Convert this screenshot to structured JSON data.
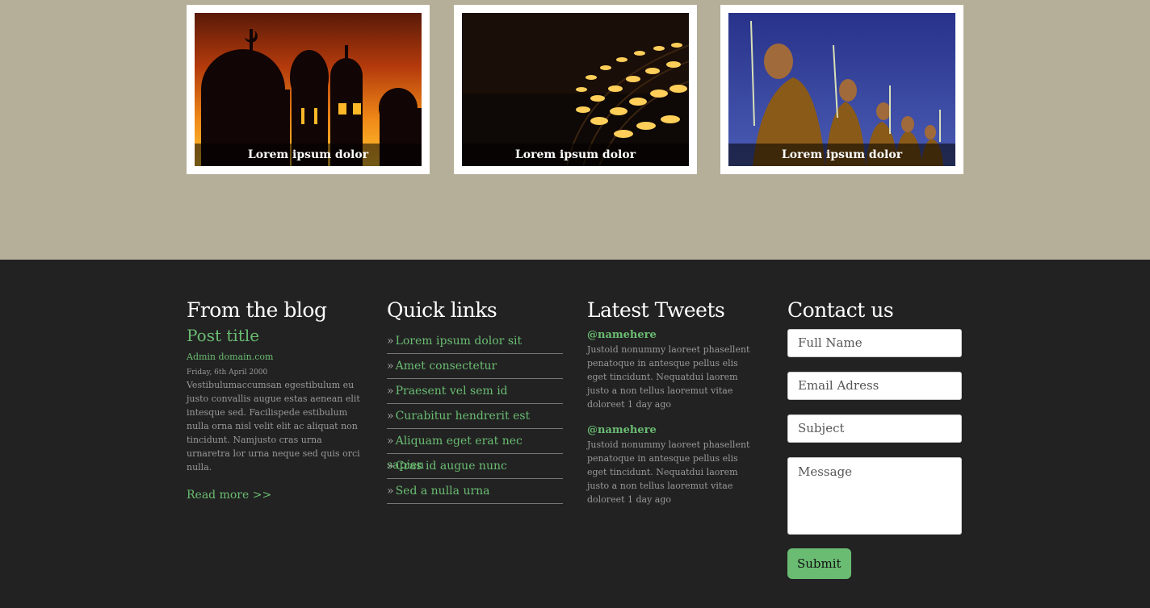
{
  "gallery": {
    "items": [
      {
        "caption": "Lorem ipsum dolor",
        "image": "mosque-silhouette-sunset"
      },
      {
        "caption": "Lorem ipsum dolor",
        "image": "candles-lit"
      },
      {
        "caption": "Lorem ipsum dolor",
        "image": "monks-procession"
      }
    ]
  },
  "footer": {
    "blog": {
      "heading": "From the blog",
      "post_title": "Post title",
      "author": "Admin domain.com",
      "date": "Friday, 6th April 2000",
      "excerpt": "Vestibulumaccumsan egestibulum eu justo convallis augue estas aenean elit intesque sed. Facilispede estibulum nulla orna nisl velit elit ac aliquat non tincidunt. Namjusto cras urna urnaretra lor urna neque sed quis orci nulla.",
      "read_more": "Read more >>"
    },
    "quick_links": {
      "heading": "Quick links",
      "items": [
        "Lorem ipsum dolor sit",
        "Amet consectetur",
        "Praesent vel sem id",
        "Curabitur hendrerit est",
        "Aliquam eget erat nec sapien",
        "Cras id augue nunc",
        "Sed a nulla urna"
      ]
    },
    "tweets": {
      "heading": "Latest Tweets",
      "items": [
        {
          "handle": "@namehere",
          "text": "Justoid nonummy laoreet phasellent penatoque in antesque pellus elis eget tincidunt. Nequatdui laorem justo a non tellus laoremut vitae doloreet 1 day ago"
        },
        {
          "handle": "@namehere",
          "text": "Justoid nonummy laoreet phasellent penatoque in antesque pellus elis eget tincidunt. Nequatdui laorem justo a non tellus laoremut vitae doloreet 1 day ago"
        }
      ]
    },
    "contact": {
      "heading": "Contact us",
      "name_placeholder": "Full Name",
      "email_placeholder": "Email Adress",
      "subject_placeholder": "Subject",
      "message_placeholder": "Message",
      "submit_label": "Submit"
    }
  },
  "colors": {
    "accent": "#6abc72",
    "page_background": "#b5ae98",
    "footer_background": "#222222"
  }
}
